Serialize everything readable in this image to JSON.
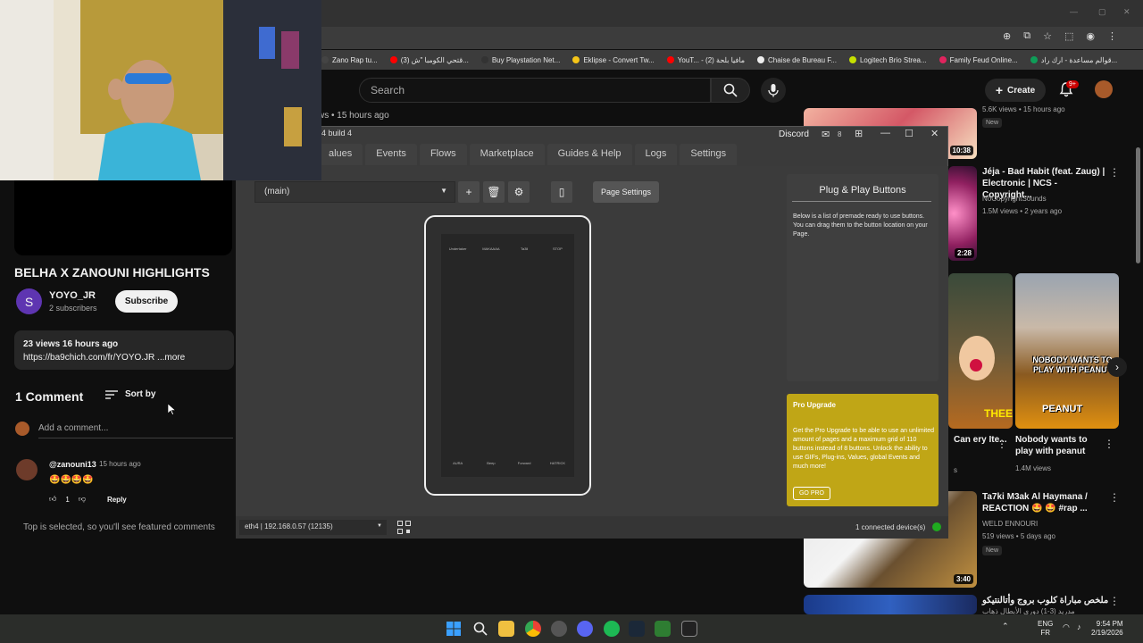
{
  "browser": {
    "bookmarks": [
      {
        "label": "Zano Rap tu...",
        "color": "#444"
      },
      {
        "label": "(3) قتحي الكومبا \"ش...",
        "color": "#ff0000"
      },
      {
        "label": "Buy Playstation Net...",
        "color": "#333"
      },
      {
        "label": "Eklipse - Convert Tw...",
        "color": "#f5c518"
      },
      {
        "label": "YouT... - مافيا بلحة (2)",
        "color": "#ff0000"
      },
      {
        "label": "Chaise de Bureau F...",
        "color": "#eeeeee"
      },
      {
        "label": "Logitech Brio Strea...",
        "color": "#c6e000"
      },
      {
        "label": "Family Feud Online...",
        "color": "#e0245e"
      },
      {
        "label": "قوالم مساعدة - ارك راد...",
        "color": "#0f9d58"
      }
    ]
  },
  "youtube": {
    "search_placeholder": "Search",
    "create_label": "Create",
    "notif_badge": "9+",
    "video_title": "BELHA X ZANOUNI HIGHLIGHTS",
    "channel_initial": "S",
    "channel_name": "YOYO_JR",
    "channel_subs": "2 subscribers",
    "subscribe_label": "Subscribe",
    "desc_meta": "23 views  16 hours ago",
    "desc_link": "https://ba9chich.com/fr/YOYO.JR ...more",
    "comments_count": "1 Comment",
    "sort_label": "Sort by",
    "add_comment_placeholder": "Add a comment...",
    "comment": {
      "author": "@zanouni13",
      "time": "15 hours ago",
      "body": "🤩🤩🤩🤩",
      "likes": "1",
      "reply_label": "Reply"
    },
    "top_note": "Top is selected, so you'll see featured comments",
    "behind_views": "ws • 15 hours ago",
    "related": [
      {
        "meta_top": "5.6K views • 15 hours ago",
        "new": "New",
        "duration": "10:38"
      },
      {
        "title": "Jéja - Bad Habit (feat. Zaug) | Electronic | NCS - Copyright...",
        "channel": "NoCopyrightSounds",
        "meta": "1.5M views • 2 years ago",
        "duration": "2:28"
      },
      {
        "title_left": "Can ery Ite...",
        "title": "Nobody wants to play with peanut",
        "meta": "1.4M views",
        "thumb_text_1": "NOBODY WANTS TO PLAY WITH PEANUT",
        "thumb_text_2": "PEANUT",
        "thumb_left_text": "THEE",
        "meta_left": "s"
      },
      {
        "title": "Ta7ki M3ak Al Haymana / REACTION 🤩 🤩 #rap ...",
        "channel": "WELD ENNOURI",
        "meta": "519 views • 5 days ago",
        "new": "New",
        "duration": "3:40"
      },
      {
        "title": "ملخص مباراة كلوب بروج وأتالنتيكو",
        "subtitle": "مدريد (3-1) دوري الأبطال ذهاب"
      }
    ]
  },
  "app": {
    "title_fragment": "4 build 4",
    "discord_label": "Discord",
    "mail_count": "8",
    "nav_tabs": [
      "alues",
      "Events",
      "Flows",
      "Marketplace",
      "Guides & Help",
      "Logs",
      "Settings"
    ],
    "page_select": "(main)",
    "page_settings_label": "Page Settings",
    "phone_top_buttons": [
      "Undertaker",
      "MAKAAAA",
      "Ta3ll",
      "STOP"
    ],
    "phone_bottom_buttons": [
      "AURA",
      "Beep",
      "Forward",
      "HATRICK"
    ],
    "plug_title": "Plug & Play Buttons",
    "plug_desc": "Below is a list of premade ready to use buttons. You can drag them to the button location on your Page.",
    "pro_title": "Pro Upgrade",
    "pro_desc": "Get the Pro Upgrade to be able to use an unlimited amount of pages and a maximum grid of 110 buttons instead of 8 buttons. Unlock the ability to use GIFs, Plug-ins, Values, global Events and much more!",
    "go_pro_label": "GO PRO",
    "network": "eth4 | 192.168.0.57 (12135)",
    "connected": "1 connected device(s)"
  },
  "taskbar": {
    "lang_1": "ENG",
    "lang_2": "FR",
    "time": "9:54 PM",
    "date": "2/19/2026"
  },
  "colors": {
    "accent_red": "#ff0000",
    "pro_gold": "#c0a616",
    "connected_green": "#1faa1f"
  }
}
